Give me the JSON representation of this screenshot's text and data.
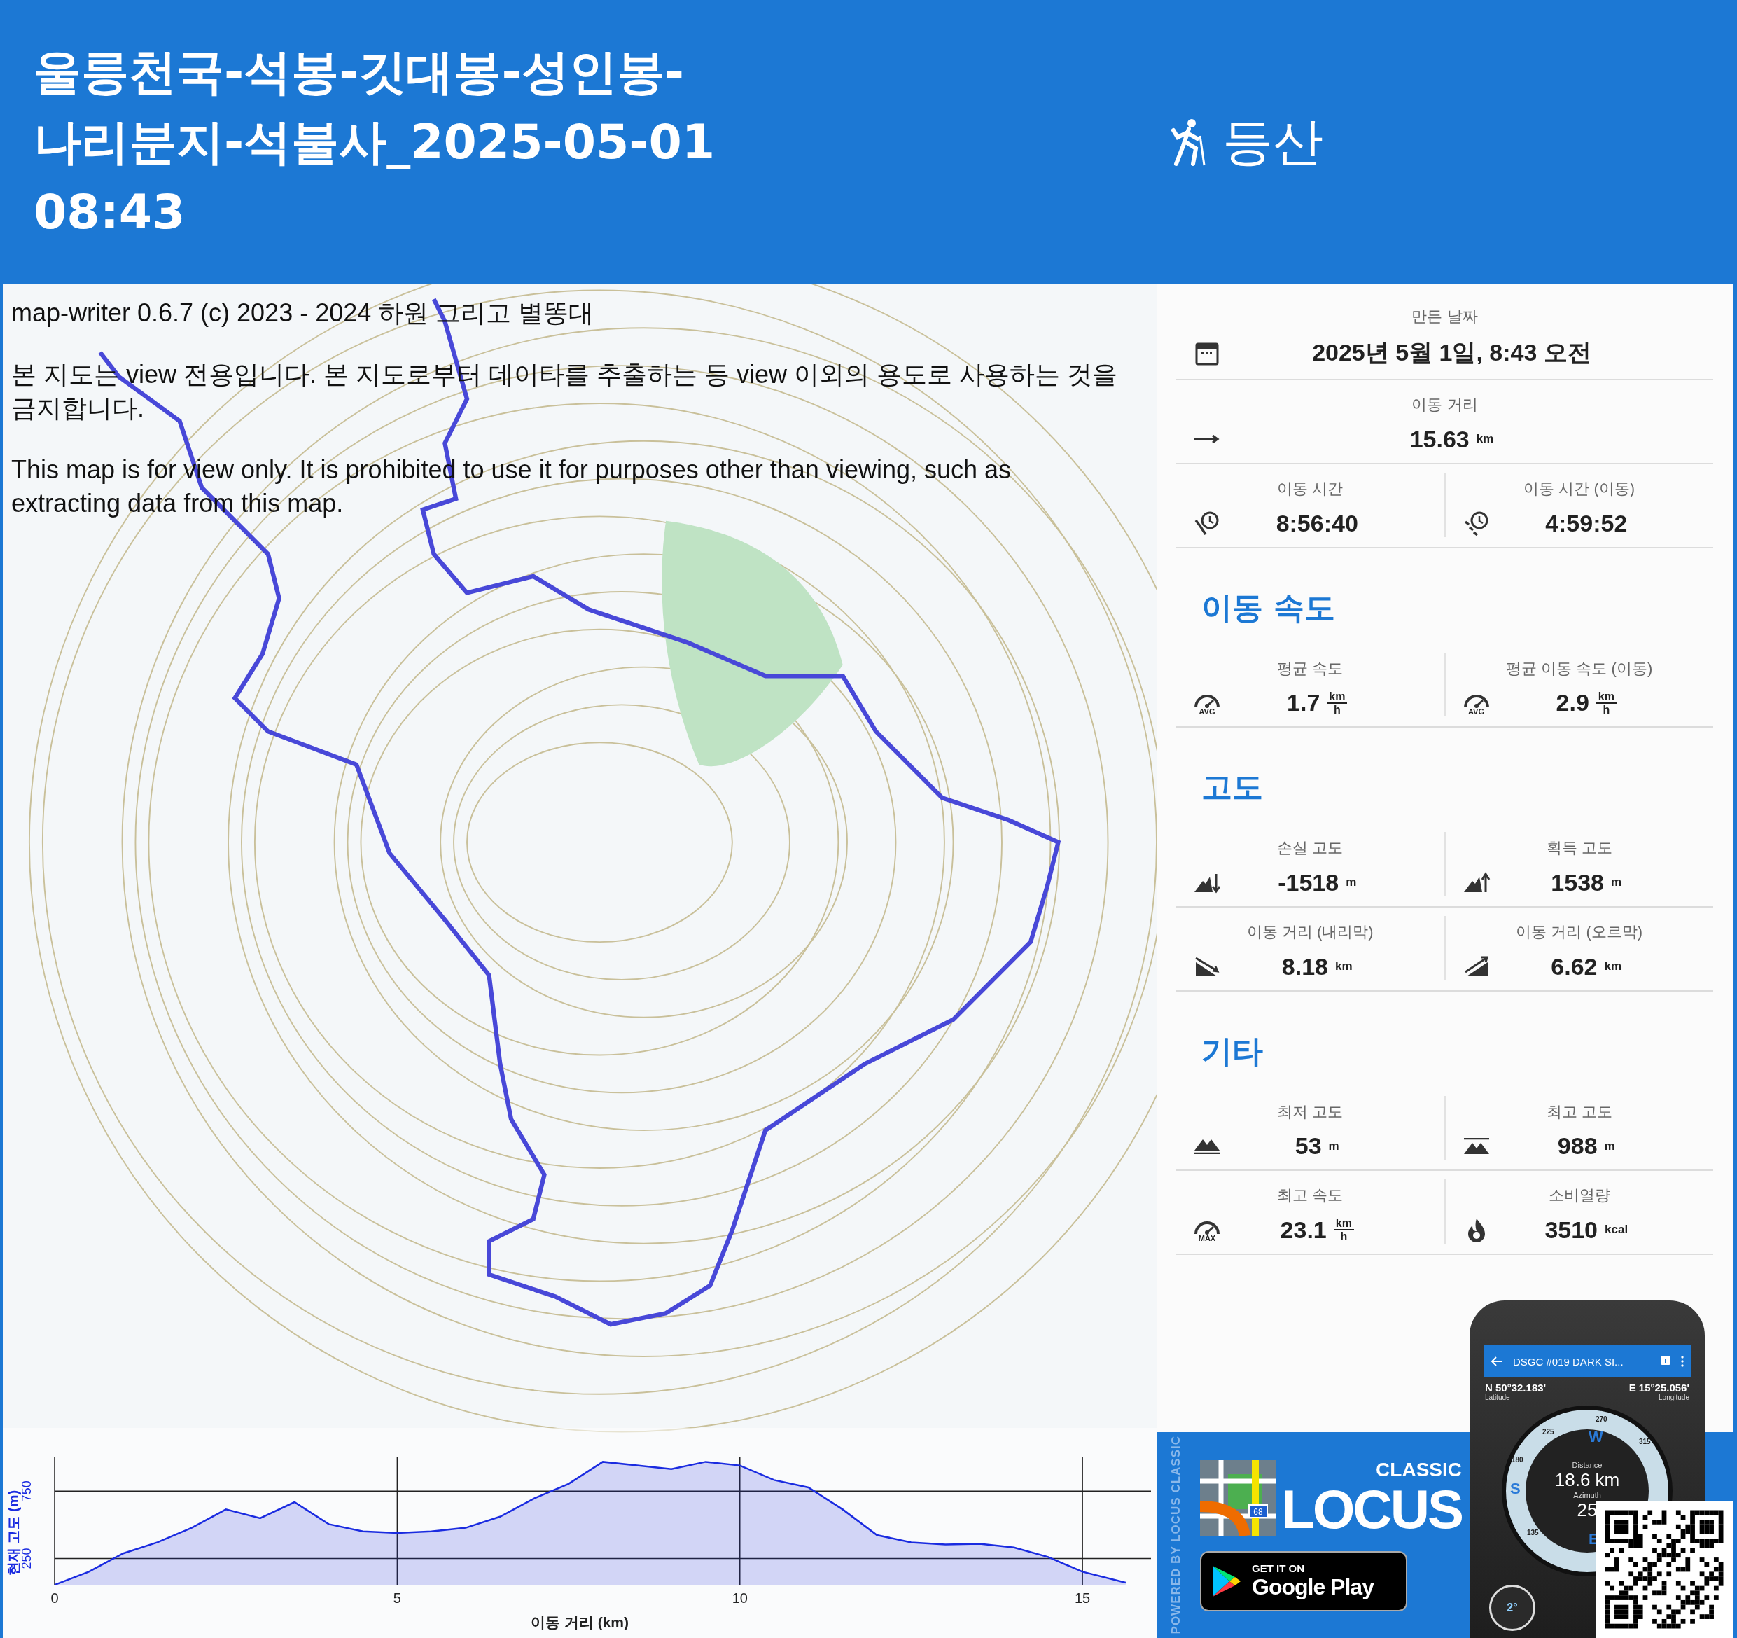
{
  "header": {
    "title_lines": [
      "울릉천국-석봉-깃대봉-성인봉-",
      "나리분지-석불사_2025-05-01",
      "08:43"
    ],
    "activity": "등산"
  },
  "map": {
    "notice": [
      "map-writer 0.6.7 (c) 2023 - 2024 하원 그리고 별똥대",
      "본 지도는 view 전용입니다. 본 지도로부터 데이타를 추출하는 등 view 이외의 용도로 사용하는 것을 금지합니다.",
      "This map is for view only. It is prohibited to use it for purposes other than viewing, such as extracting data from this map."
    ],
    "chart_data": {
      "type": "line",
      "xlabel": "이동 거리 (km)",
      "ylabel": "현재 고도 (m)",
      "grid": true,
      "xlim": [
        0,
        16
      ],
      "ylim": [
        50,
        1000
      ],
      "xticks": [
        0,
        5,
        10,
        15
      ],
      "yticks": [
        250,
        750
      ],
      "x": [
        0,
        0.5,
        1,
        1.5,
        2,
        2.5,
        3,
        3.5,
        4,
        4.5,
        5,
        5.5,
        6,
        6.5,
        7,
        7.5,
        8,
        8.5,
        9,
        9.5,
        10,
        10.5,
        11,
        11.5,
        12,
        12.5,
        13,
        13.5,
        14,
        14.5,
        15,
        15.63
      ],
      "series": [
        {
          "color": "#1a2be0",
          "values": [
            54,
            152,
            288,
            370,
            478,
            614,
            549,
            668,
            505,
            451,
            440,
            451,
            478,
            560,
            696,
            804,
            967,
            940,
            913,
            967,
            940,
            832,
            777,
            614,
            424,
            370,
            353,
            359,
            332,
            261,
            152,
            71
          ]
        }
      ]
    }
  },
  "stats": {
    "rows": [
      {
        "cells": [
          {
            "label": "만든 날짜",
            "kind": "calendar",
            "value": "2025년 5월 1일, 8:43 오전"
          }
        ]
      },
      {
        "cells": [
          {
            "label": "이동 거리",
            "kind": "arrow",
            "value": "15.63",
            "unit": "km"
          }
        ]
      },
      {
        "cells": [
          {
            "label": "이동 시간",
            "kind": "clock-track",
            "value": "8:56:40"
          },
          {
            "label": "이동 시간 (이동)",
            "kind": "clock-moving",
            "value": "4:59:52"
          }
        ]
      }
    ],
    "sections": [
      {
        "title": "이동 속도",
        "rows": [
          {
            "cells": [
              {
                "label": "평균 속도",
                "kind": "gauge",
                "badge": "AVG",
                "value": "1.7",
                "unit": "km",
                "unit_denominator": "h"
              },
              {
                "label": "평균 이동 속도 (이동)",
                "kind": "gauge-moving",
                "badge": "AVG",
                "value": "2.9",
                "unit": "km",
                "unit_denominator": "h"
              }
            ]
          }
        ]
      },
      {
        "title": "고도",
        "rows": [
          {
            "cells": [
              {
                "label": "손실 고도",
                "kind": "mountain-down",
                "value": "-1518",
                "unit": "m"
              },
              {
                "label": "획득 고도",
                "kind": "mountain-up",
                "value": "1538",
                "unit": "m"
              }
            ]
          },
          {
            "cells": [
              {
                "label": "이동 거리 (내리막)",
                "kind": "slope-down",
                "value": "8.18",
                "unit": "km"
              },
              {
                "label": "이동 거리 (오르막)",
                "kind": "slope-up",
                "value": "6.62",
                "unit": "km"
              }
            ]
          }
        ]
      },
      {
        "title": "기타",
        "rows": [
          {
            "cells": [
              {
                "label": "최저 고도",
                "kind": "mountain-low",
                "value": "53",
                "unit": "m"
              },
              {
                "label": "최고 고도",
                "kind": "mountain-high",
                "value": "988",
                "unit": "m"
              }
            ]
          },
          {
            "cells": [
              {
                "label": "최고 속도",
                "kind": "gauge",
                "badge": "MAX",
                "value": "23.1",
                "unit": "km",
                "unit_denominator": "h"
              },
              {
                "label": "소비열량",
                "kind": "flame",
                "value": "3510",
                "unit": "kcal"
              }
            ]
          }
        ]
      }
    ]
  },
  "ad": {
    "powered": "POWERED BY LOCUS CLASSIC",
    "logo_small": "CLASSIC",
    "logo": "LOCUS",
    "logo_badge": "68",
    "store_small": "GET IT ON",
    "store": "Google Play",
    "phone": {
      "title": "DSGC #019 DARK SI...",
      "lat": "N 50°32.183'",
      "lat_label": "Latitude",
      "lon": "E 15°25.056'",
      "lon_label": "Longitude",
      "distance_label": "Distance",
      "distance": "18.6 km",
      "azimuth_label": "Azimuth",
      "azimuth": "25",
      "compass_letters": [
        "W",
        "S",
        "E"
      ],
      "compass_degrees": [
        "270",
        "315",
        "225",
        "180",
        "135"
      ],
      "tilt": "2°"
    }
  }
}
